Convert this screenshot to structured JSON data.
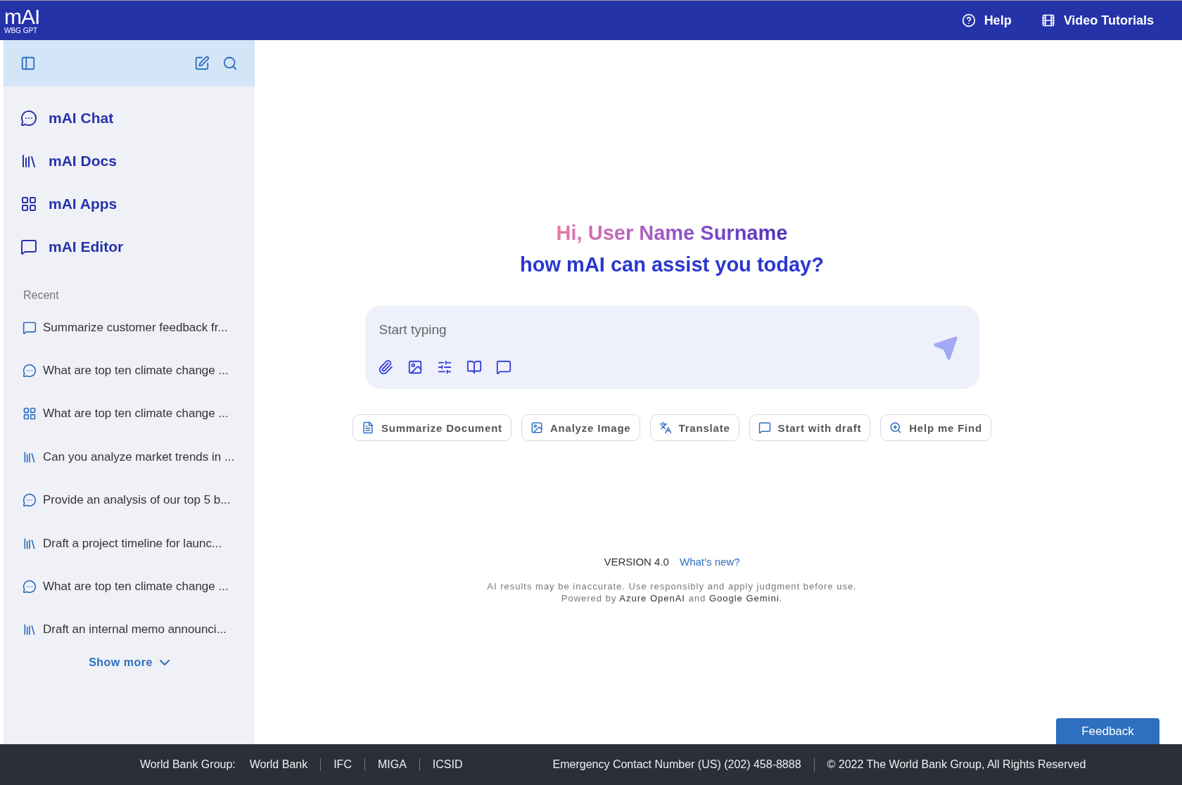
{
  "header": {
    "logo": "mAI",
    "logo_subtitle": "WBG GPT",
    "links": [
      {
        "kind": "help",
        "label": "Help"
      },
      {
        "kind": "video",
        "label": "Video Tutorials"
      }
    ]
  },
  "sidebar": {
    "nav": [
      {
        "kind": "chat",
        "label": "mAI Chat"
      },
      {
        "kind": "docs",
        "label": "mAI Docs"
      },
      {
        "kind": "apps",
        "label": "mAI Apps"
      },
      {
        "kind": "editor",
        "label": "mAI Editor"
      }
    ],
    "recent_title": "Recent",
    "recent": [
      {
        "kind": "editor",
        "label": "Summarize customer feedback fr..."
      },
      {
        "kind": "chat",
        "label": "What are top ten climate change ..."
      },
      {
        "kind": "apps",
        "label": "What are top ten climate change ..."
      },
      {
        "kind": "docs",
        "label": "Can you analyze market trends in ..."
      },
      {
        "kind": "chat",
        "label": "Provide an analysis of our top 5 b..."
      },
      {
        "kind": "docs",
        "label": "Draft a project timeline for launc..."
      },
      {
        "kind": "chat",
        "label": "What are top ten climate change ..."
      },
      {
        "kind": "docs",
        "label": "Draft an internal memo announci..."
      }
    ],
    "show_more": "Show more"
  },
  "main": {
    "greeting": "Hi, User Name Surname",
    "subtitle": "how mAI can assist you today?",
    "input": {
      "placeholder": "Start typing"
    },
    "chips": [
      "Summarize Document",
      "Analyze Image",
      "Translate",
      "Start with draft",
      "Help me Find"
    ],
    "version": "VERSION 4.0",
    "whats_new": "What’s new?",
    "disclaimer": "AI results may be inaccurate. Use responsibly and apply judgment before use.",
    "powered_by": "Powered by **Azure OpenAI** and **Google Gemini**.",
    "feedback": "Feedback"
  },
  "footer": {
    "group_label": "World Bank Group:",
    "links": [
      "World Bank",
      "IFC",
      "MIGA",
      "ICSID"
    ],
    "emergency": "Emergency Contact Number (US) (202) 458-8888",
    "copyright": "© 2022 The World Bank Group, All Rights Reserved"
  }
}
